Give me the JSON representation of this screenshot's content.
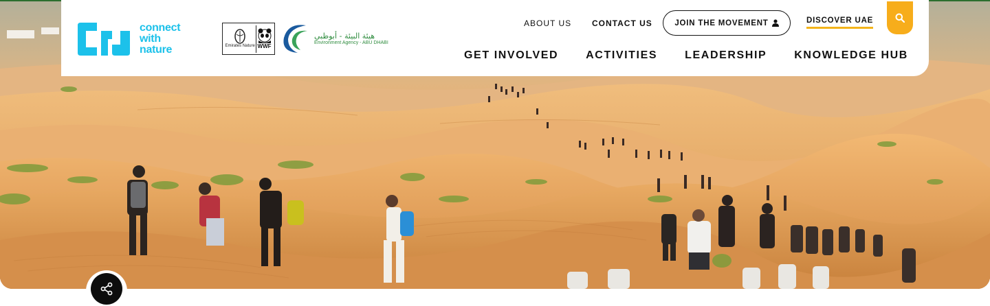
{
  "brand": {
    "logo_line1": "connect",
    "logo_line2": "with",
    "logo_line3": "nature",
    "logo_color": "#1cc1ea"
  },
  "partners": {
    "wwf_left": "Emirates Nature",
    "wwf_right": "WWF",
    "ead_arabic": "هيئة البيئة - أبوظبي",
    "ead_english": "Environment Agency - ABU DHABI"
  },
  "utility_nav": {
    "about": "ABOUT US",
    "contact": "CONTACT US",
    "join": "JOIN THE MOVEMENT",
    "discover": "DISCOVER UAE",
    "discover_underline_color": "#f4b41a"
  },
  "main_nav": {
    "items": [
      "GET INVOLVED",
      "ACTIVITIES",
      "LEADERSHIP",
      "KNOWLEDGE HUB"
    ]
  },
  "icons": {
    "search": "search-icon",
    "user": "user-icon",
    "share": "share-icon"
  },
  "colors": {
    "search_bg": "#f7ad1b",
    "share_bg": "#0d0d0d",
    "ead_green": "#2f8c3f"
  }
}
